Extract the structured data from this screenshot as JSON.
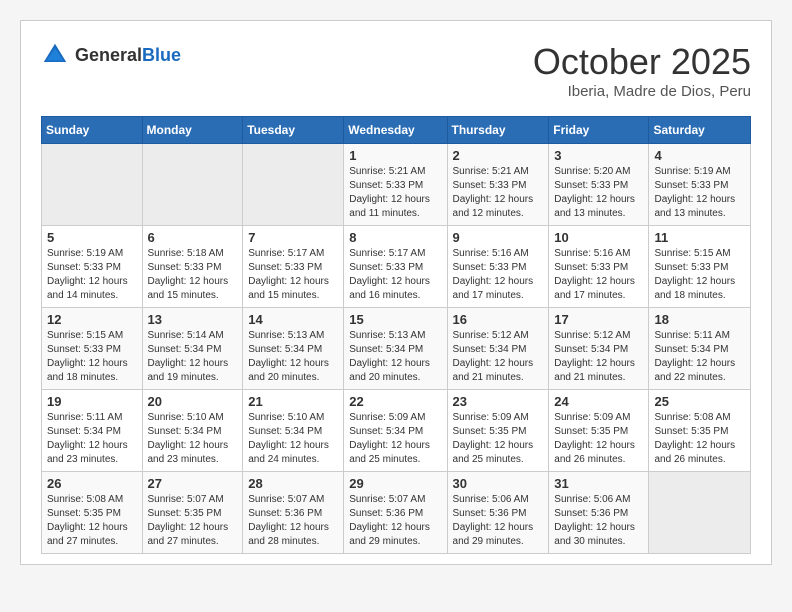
{
  "header": {
    "logo_general": "General",
    "logo_blue": "Blue",
    "month": "October 2025",
    "location": "Iberia, Madre de Dios, Peru"
  },
  "days_of_week": [
    "Sunday",
    "Monday",
    "Tuesday",
    "Wednesday",
    "Thursday",
    "Friday",
    "Saturday"
  ],
  "weeks": [
    [
      {
        "day": "",
        "info": ""
      },
      {
        "day": "",
        "info": ""
      },
      {
        "day": "",
        "info": ""
      },
      {
        "day": "1",
        "info": "Sunrise: 5:21 AM\nSunset: 5:33 PM\nDaylight: 12 hours and 11 minutes."
      },
      {
        "day": "2",
        "info": "Sunrise: 5:21 AM\nSunset: 5:33 PM\nDaylight: 12 hours and 12 minutes."
      },
      {
        "day": "3",
        "info": "Sunrise: 5:20 AM\nSunset: 5:33 PM\nDaylight: 12 hours and 13 minutes."
      },
      {
        "day": "4",
        "info": "Sunrise: 5:19 AM\nSunset: 5:33 PM\nDaylight: 12 hours and 13 minutes."
      }
    ],
    [
      {
        "day": "5",
        "info": "Sunrise: 5:19 AM\nSunset: 5:33 PM\nDaylight: 12 hours and 14 minutes."
      },
      {
        "day": "6",
        "info": "Sunrise: 5:18 AM\nSunset: 5:33 PM\nDaylight: 12 hours and 15 minutes."
      },
      {
        "day": "7",
        "info": "Sunrise: 5:17 AM\nSunset: 5:33 PM\nDaylight: 12 hours and 15 minutes."
      },
      {
        "day": "8",
        "info": "Sunrise: 5:17 AM\nSunset: 5:33 PM\nDaylight: 12 hours and 16 minutes."
      },
      {
        "day": "9",
        "info": "Sunrise: 5:16 AM\nSunset: 5:33 PM\nDaylight: 12 hours and 17 minutes."
      },
      {
        "day": "10",
        "info": "Sunrise: 5:16 AM\nSunset: 5:33 PM\nDaylight: 12 hours and 17 minutes."
      },
      {
        "day": "11",
        "info": "Sunrise: 5:15 AM\nSunset: 5:33 PM\nDaylight: 12 hours and 18 minutes."
      }
    ],
    [
      {
        "day": "12",
        "info": "Sunrise: 5:15 AM\nSunset: 5:33 PM\nDaylight: 12 hours and 18 minutes."
      },
      {
        "day": "13",
        "info": "Sunrise: 5:14 AM\nSunset: 5:34 PM\nDaylight: 12 hours and 19 minutes."
      },
      {
        "day": "14",
        "info": "Sunrise: 5:13 AM\nSunset: 5:34 PM\nDaylight: 12 hours and 20 minutes."
      },
      {
        "day": "15",
        "info": "Sunrise: 5:13 AM\nSunset: 5:34 PM\nDaylight: 12 hours and 20 minutes."
      },
      {
        "day": "16",
        "info": "Sunrise: 5:12 AM\nSunset: 5:34 PM\nDaylight: 12 hours and 21 minutes."
      },
      {
        "day": "17",
        "info": "Sunrise: 5:12 AM\nSunset: 5:34 PM\nDaylight: 12 hours and 21 minutes."
      },
      {
        "day": "18",
        "info": "Sunrise: 5:11 AM\nSunset: 5:34 PM\nDaylight: 12 hours and 22 minutes."
      }
    ],
    [
      {
        "day": "19",
        "info": "Sunrise: 5:11 AM\nSunset: 5:34 PM\nDaylight: 12 hours and 23 minutes."
      },
      {
        "day": "20",
        "info": "Sunrise: 5:10 AM\nSunset: 5:34 PM\nDaylight: 12 hours and 23 minutes."
      },
      {
        "day": "21",
        "info": "Sunrise: 5:10 AM\nSunset: 5:34 PM\nDaylight: 12 hours and 24 minutes."
      },
      {
        "day": "22",
        "info": "Sunrise: 5:09 AM\nSunset: 5:34 PM\nDaylight: 12 hours and 25 minutes."
      },
      {
        "day": "23",
        "info": "Sunrise: 5:09 AM\nSunset: 5:35 PM\nDaylight: 12 hours and 25 minutes."
      },
      {
        "day": "24",
        "info": "Sunrise: 5:09 AM\nSunset: 5:35 PM\nDaylight: 12 hours and 26 minutes."
      },
      {
        "day": "25",
        "info": "Sunrise: 5:08 AM\nSunset: 5:35 PM\nDaylight: 12 hours and 26 minutes."
      }
    ],
    [
      {
        "day": "26",
        "info": "Sunrise: 5:08 AM\nSunset: 5:35 PM\nDaylight: 12 hours and 27 minutes."
      },
      {
        "day": "27",
        "info": "Sunrise: 5:07 AM\nSunset: 5:35 PM\nDaylight: 12 hours and 27 minutes."
      },
      {
        "day": "28",
        "info": "Sunrise: 5:07 AM\nSunset: 5:36 PM\nDaylight: 12 hours and 28 minutes."
      },
      {
        "day": "29",
        "info": "Sunrise: 5:07 AM\nSunset: 5:36 PM\nDaylight: 12 hours and 29 minutes."
      },
      {
        "day": "30",
        "info": "Sunrise: 5:06 AM\nSunset: 5:36 PM\nDaylight: 12 hours and 29 minutes."
      },
      {
        "day": "31",
        "info": "Sunrise: 5:06 AM\nSunset: 5:36 PM\nDaylight: 12 hours and 30 minutes."
      },
      {
        "day": "",
        "info": ""
      }
    ]
  ]
}
